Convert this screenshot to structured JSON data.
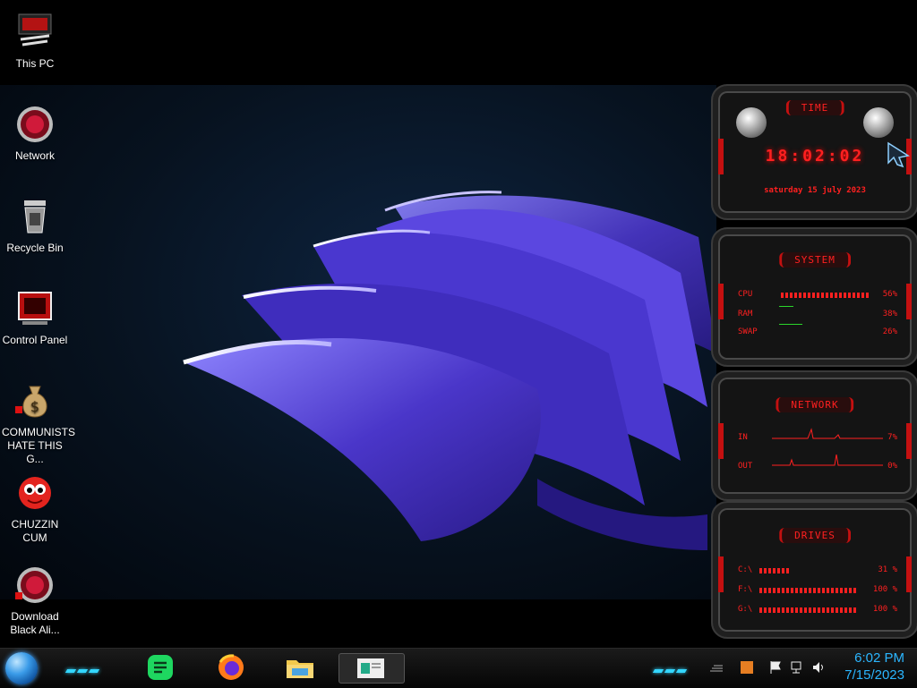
{
  "desktop": {
    "icons": [
      {
        "label": "This PC",
        "icon": "computer-icon"
      },
      {
        "label": "Network",
        "icon": "network-icon"
      },
      {
        "label": "Recycle Bin",
        "icon": "recycle-bin-icon"
      },
      {
        "label": "Control Panel",
        "icon": "control-panel-icon"
      },
      {
        "label": "COMMUNISTS HATE THIS G...",
        "icon": "money-bag-icon"
      },
      {
        "label": "CHUZZIN CUM",
        "icon": "chuzzle-icon"
      },
      {
        "label": "Download Black Ali...",
        "icon": "alien-download-icon"
      }
    ]
  },
  "gadgets": {
    "time": {
      "title": "TIME",
      "clock": "18:02:02",
      "date": "saturday 15 july 2023"
    },
    "system": {
      "title": "SYSTEM",
      "rows": [
        {
          "name": "CPU",
          "pct": "56%",
          "value": 0.56
        },
        {
          "name": "RAM",
          "pct": "38%",
          "value": 0.38
        },
        {
          "name": "SWAP",
          "pct": "26%",
          "value": 0.26
        }
      ]
    },
    "network": {
      "title": "NETWORK",
      "rows": [
        {
          "name": "IN",
          "pct": "7%"
        },
        {
          "name": "OUT",
          "pct": "0%"
        }
      ]
    },
    "drives": {
      "title": "DRIVES",
      "rows": [
        {
          "name": "C:\\",
          "pct": "31 %",
          "value": 0.31
        },
        {
          "name": "F:\\",
          "pct": "100 %",
          "value": 1.0
        },
        {
          "name": "G:\\",
          "pct": "100 %",
          "value": 1.0
        }
      ]
    }
  },
  "taskbar": {
    "apps": [
      {
        "name": "notes-app",
        "icon": "notes-icon"
      },
      {
        "name": "firefox",
        "icon": "firefox-icon"
      },
      {
        "name": "file-explorer",
        "icon": "folder-icon"
      },
      {
        "name": "active-window",
        "icon": "window-thumbnail-icon"
      }
    ],
    "clock_time": "6:02 PM",
    "clock_date": "7/15/2023"
  },
  "colors": {
    "accent_red": "#ff2020",
    "accent_cyan": "#33d6ff",
    "wallpaper_purple": "#5a4bd6"
  }
}
